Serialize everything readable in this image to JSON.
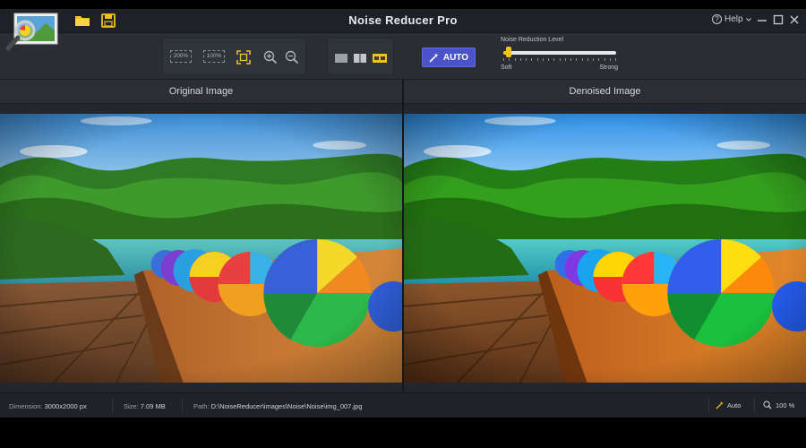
{
  "window": {
    "title": "Noise Reducer Pro",
    "help_label": "Help"
  },
  "toolbar": {
    "zoom_200_label": "200%",
    "zoom_100_label": "100%",
    "auto_label": "AUTO",
    "noise_reduction": {
      "label": "Noise Reduction Level",
      "min_label": "Soft",
      "max_label": "Strong",
      "value": 0.03
    }
  },
  "panels": {
    "original_label": "Original Image",
    "denoised_label": "Denoised Image"
  },
  "status": {
    "dimension_label": "Dimension:",
    "dimension_value": "3000x2000 px",
    "size_label": "Size:",
    "size_value": "7.09 MB",
    "path_label": "Path:",
    "path_value": "D:\\NoiseReducer\\images\\Noise\\Noise\\img_007.jpg",
    "auto_label": "Auto",
    "zoom_value": "100 %"
  },
  "colors": {
    "accent": "#4b53c9",
    "slider": "#f2c21b",
    "folder": "#f2c21b"
  }
}
